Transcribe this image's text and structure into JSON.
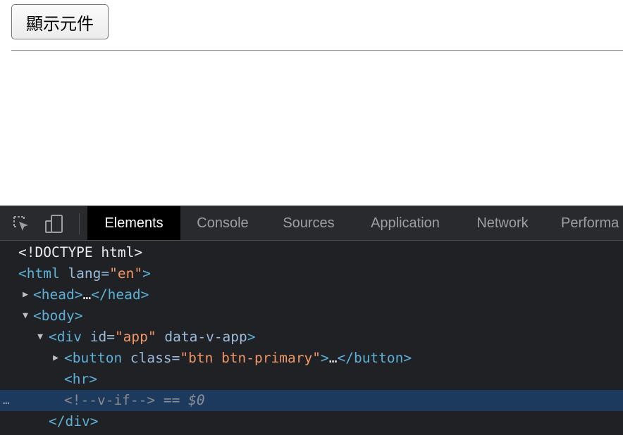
{
  "page": {
    "button_label": "顯示元件"
  },
  "devtools": {
    "tabs": [
      "Elements",
      "Console",
      "Sources",
      "Application",
      "Network",
      "Performa"
    ],
    "active_tab": "Elements",
    "icons": [
      "inspect-element-icon",
      "device-toolbar-icon"
    ],
    "dom": {
      "doctype": "<!DOCTYPE html>",
      "html_open": "<html",
      "html_lang_attr": " lang=",
      "html_lang_val": "\"en\"",
      "html_close": ">",
      "head_open": "<head>",
      "head_ellipsis": "…",
      "head_close": "</head>",
      "body_open": "<body>",
      "div_open": "<div",
      "div_id_attr": " id=",
      "div_id_val": "\"app\"",
      "div_data_attr": " data-v-app",
      "div_open_close": ">",
      "button_open": "<button",
      "button_class_attr": " class=",
      "button_class_val": "\"btn btn-primary\"",
      "button_open_close": ">",
      "button_ellipsis": "…",
      "button_close": "</button>",
      "hr": "<hr>",
      "comment": "<!--v-if-->",
      "selected_marker": " == $0",
      "row_dots": "…",
      "div_close": "</div>"
    },
    "colors": {
      "panel_bg": "#202124",
      "toolbar_bg": "#292a2d",
      "tag": "#5db0d7",
      "attr_value": "#f29766",
      "selected_row": "#1c3a5e"
    }
  }
}
